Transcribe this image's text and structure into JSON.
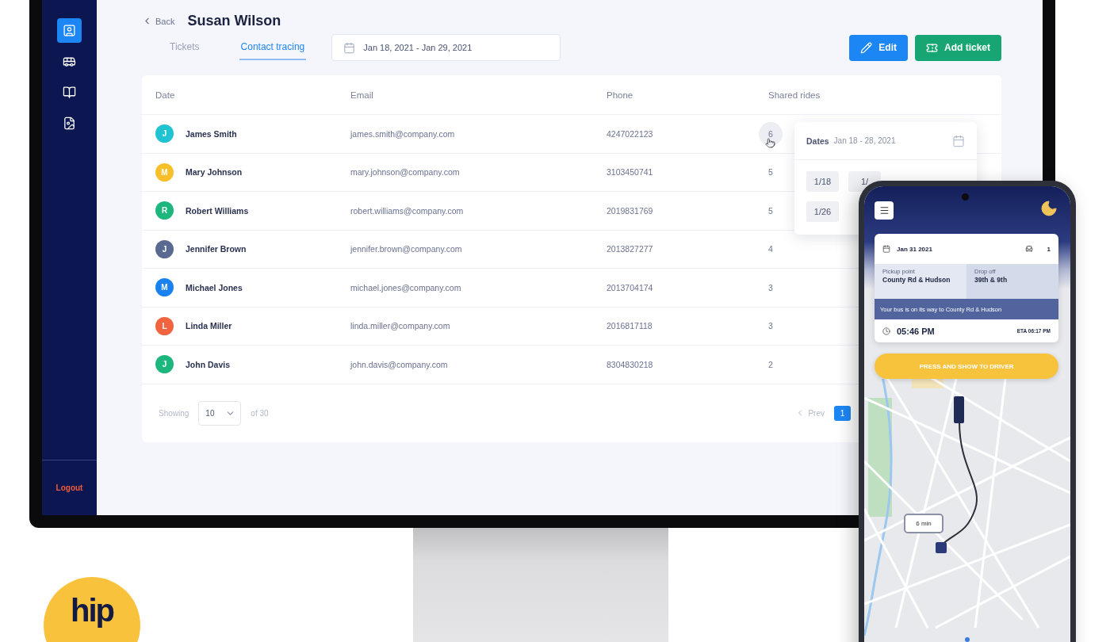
{
  "sidebar": {
    "nav": [
      {
        "selected": true
      },
      {
        "selected": false
      },
      {
        "selected": false
      },
      {
        "selected": false
      }
    ],
    "logout": "Logout"
  },
  "header": {
    "back": "Back",
    "title": "Susan Wilson",
    "tabs": [
      {
        "label": "Tickets",
        "selected": false
      },
      {
        "label": "Contact tracing",
        "selected": true
      }
    ],
    "date_range": "Jan 18, 2021 - Jan 29, 2021",
    "actions": [
      {
        "kind": "edit",
        "label": "Edit"
      },
      {
        "kind": "add",
        "label": "Add ticket"
      }
    ]
  },
  "table": {
    "columns": [
      "Date",
      "Email",
      "Phone",
      "Shared rides"
    ],
    "rows": [
      {
        "initial": "J",
        "color": "#1fc3d1",
        "name": "James Smith",
        "email": "james.smith@company.com",
        "phone": "4247022123",
        "shared_rides": "6",
        "highlighted": true
      },
      {
        "initial": "M",
        "color": "#f7c02a",
        "name": "Mary Johnson",
        "email": "mary.johnson@company.com",
        "phone": "3103450741",
        "shared_rides": "5",
        "highlighted": false
      },
      {
        "initial": "R",
        "color": "#1db77e",
        "name": "Robert Williams",
        "email": "robert.williams@company.com",
        "phone": "2019831769",
        "shared_rides": "5",
        "highlighted": false
      },
      {
        "initial": "J",
        "color": "#5a6990",
        "name": "Jennifer Brown",
        "email": "jennifer.brown@company.com",
        "phone": "2013827277",
        "shared_rides": "4",
        "highlighted": false
      },
      {
        "initial": "M",
        "color": "#1a82f0",
        "name": "Michael Jones",
        "email": "michael.jones@company.com",
        "phone": "2013704174",
        "shared_rides": "3",
        "highlighted": false
      },
      {
        "initial": "L",
        "color": "#f2643f",
        "name": "Linda Miller",
        "email": "linda.miller@company.com",
        "phone": "2016817118",
        "shared_rides": "3",
        "highlighted": false
      },
      {
        "initial": "J",
        "color": "#1db77e",
        "name": "John Davis",
        "email": "john.davis@company.com",
        "phone": "8304830218",
        "shared_rides": "2",
        "highlighted": false
      }
    ],
    "popover": {
      "label": "Dates",
      "range": "Jan 18 - 28, 2021",
      "dates": [
        [
          "1/18",
          "1/"
        ],
        [
          "1/26"
        ]
      ]
    },
    "footer": {
      "showing": "Showing",
      "page_size": "10",
      "of": "of 30",
      "prev": "Prev",
      "pages": [
        {
          "label": "1",
          "selected": true
        }
      ]
    }
  },
  "phone": {
    "date": "Jan 31 2021",
    "seats": "1",
    "pickup": {
      "label": "Pickup point",
      "value": "County Rd & Hudson"
    },
    "dropoff": {
      "label": "Drop off",
      "value": "39th & 9th"
    },
    "banner": "Your bus is on its way to County Rd & Hudson",
    "time": "05:46 PM",
    "eta": "ETA 06:17 PM",
    "button": "PRESS AND SHOW TO DRIVER",
    "map_label": "6 min"
  },
  "logo": "hip"
}
